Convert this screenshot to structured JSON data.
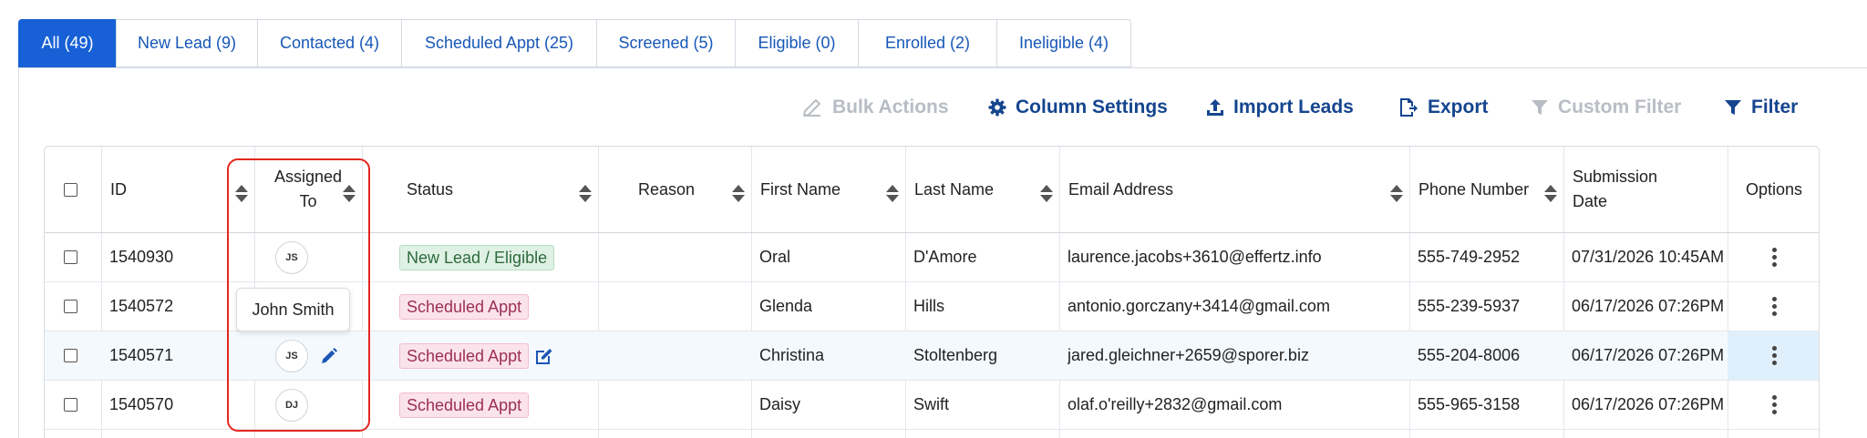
{
  "tabs": [
    {
      "label": "All (49)",
      "active": true
    },
    {
      "label": "New Lead (9)"
    },
    {
      "label": "Contacted (4)"
    },
    {
      "label": "Scheduled Appt (25)"
    },
    {
      "label": "Screened (5)"
    },
    {
      "label": "Eligible (0)"
    },
    {
      "label": "Enrolled (2)"
    },
    {
      "label": "Ineligible (4)"
    }
  ],
  "toolbar": {
    "bulk_actions": "Bulk Actions",
    "column_settings": "Column Settings",
    "import_leads": "Import Leads",
    "export": "Export",
    "custom_filter": "Custom Filter",
    "filter": "Filter"
  },
  "table": {
    "headers": {
      "id": "ID",
      "assigned_to_1": "Assigned",
      "assigned_to_2": "To",
      "status": "Status",
      "reason": "Reason",
      "first_name": "First Name",
      "last_name": "Last Name",
      "email": "Email Address",
      "phone": "Phone Number",
      "submission_1": "Submission",
      "submission_2": "Date",
      "options": "Options"
    },
    "rows": [
      {
        "id": "1540930",
        "assigned": "JS",
        "status": "New Lead / Eligible",
        "first": "Oral",
        "last": "D'Amore",
        "email": "laurence.jacobs+3610@effertz.info",
        "phone": "555-749-2952",
        "date": "07/31/2026 10:45AM"
      },
      {
        "id": "1540572",
        "assigned": "",
        "status": "Scheduled Appt",
        "first": "Glenda",
        "last": "Hills",
        "email": "antonio.gorczany+3414@gmail.com",
        "phone": "555-239-5937",
        "date": "06/17/2026 07:26PM"
      },
      {
        "id": "1540571",
        "assigned": "JS",
        "status": "Scheduled Appt",
        "first": "Christina",
        "last": "Stoltenberg",
        "email": "jared.gleichner+2659@sporer.biz",
        "phone": "555-204-8006",
        "date": "06/17/2026 07:26PM"
      },
      {
        "id": "1540570",
        "assigned": "DJ",
        "status": "Scheduled Appt",
        "first": "Daisy",
        "last": "Swift",
        "email": "olaf.o'reilly+2832@gmail.com",
        "phone": "555-965-3158",
        "date": "06/17/2026 07:26PM"
      }
    ]
  },
  "tooltip": {
    "text": "John Smith"
  }
}
